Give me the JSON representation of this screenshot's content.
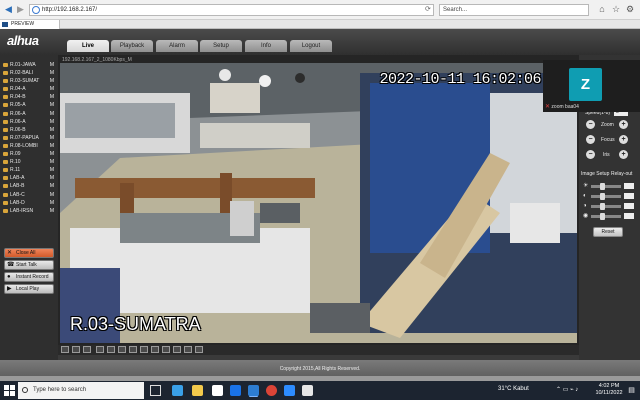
{
  "browser": {
    "url": "http://192.168.2.167/",
    "search_placeholder": "Search...",
    "tab_title": "PREVIEW"
  },
  "app": {
    "logo": "alhua",
    "tabs": [
      "Live",
      "Playback",
      "Alarm",
      "Setup",
      "Info",
      "Logout"
    ],
    "active_tab": "Live"
  },
  "channels": [
    {
      "label": "R.01-JAWA",
      "flag": "M"
    },
    {
      "label": "R.02-BALI",
      "flag": "M"
    },
    {
      "label": "R.03-SUMAT",
      "flag": "M"
    },
    {
      "label": "R.04-A",
      "flag": "M"
    },
    {
      "label": "R.04-B",
      "flag": "M"
    },
    {
      "label": "R.05-A",
      "flag": "M"
    },
    {
      "label": "R.06-A",
      "flag": "M"
    },
    {
      "label": "R.06-A",
      "flag": "M"
    },
    {
      "label": "R.06-B",
      "flag": "M"
    },
    {
      "label": "R.07-PAPUA",
      "flag": "M"
    },
    {
      "label": "R.08-LOMBI",
      "flag": "M"
    },
    {
      "label": "R.09",
      "flag": "M"
    },
    {
      "label": "R.10",
      "flag": "M"
    },
    {
      "label": "R.11",
      "flag": "M"
    },
    {
      "label": "LAB-A",
      "flag": "M"
    },
    {
      "label": "LAB-B",
      "flag": "M"
    },
    {
      "label": "LAB-C",
      "flag": "M"
    },
    {
      "label": "LAB-D",
      "flag": "M"
    },
    {
      "label": "LAB-IRSN",
      "flag": "M"
    }
  ],
  "left_buttons": {
    "close_all": "Close All",
    "start_talk": "Start Talk",
    "instant_record": "Instant Record",
    "local_play": "Local Play"
  },
  "video": {
    "stream_label": "192.168.2.167_2_1080Kbps_M",
    "osd_time": "2022-10-11 16:02:06",
    "osd_name": "R.03-SUMATRA"
  },
  "zoom": {
    "avatar_letter": "Z",
    "participant": "zoom baa04"
  },
  "ptz": {
    "speed_label": "Speed(1-8)",
    "speed_value": "5",
    "zoom_label": "Zoom",
    "focus_label": "Focus",
    "iris_label": "Iris",
    "image_setup": "Image Setup",
    "relay_out": "Relay-out",
    "reset": "Reset",
    "sliders": [
      0.35,
      0.35,
      0.35,
      0.35
    ]
  },
  "footer": {
    "copyright": "Copyright 2015,All Rights Reserved."
  },
  "taskbar": {
    "search_placeholder": "Type here to search",
    "weather": "31°C  Kabut",
    "time": "4:02 PM",
    "date": "10/11/2022"
  },
  "colors": {
    "accent": "#d9a53a",
    "close_all": "#e2703f",
    "zoom_avatar": "#0f9db2"
  }
}
